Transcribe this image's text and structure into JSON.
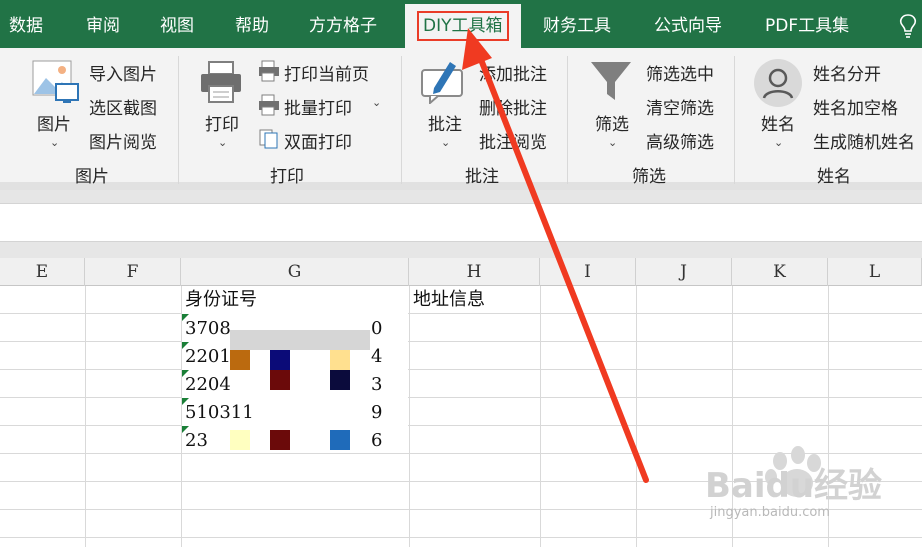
{
  "tabs": [
    "数据",
    "审阅",
    "视图",
    "帮助",
    "方方格子",
    "DIY工具箱",
    "财务工具",
    "公式向导",
    "PDF工具集"
  ],
  "active_tab": "DIY工具箱",
  "ribbon": {
    "picture": {
      "big_button": "图片",
      "items": [
        "导入图片",
        "选区截图",
        "图片阅览"
      ],
      "group_label": "图片"
    },
    "print": {
      "big_button": "打印",
      "items": [
        "打印当前页",
        "批量打印",
        "双面打印"
      ],
      "group_label": "打印"
    },
    "comment": {
      "big_button": "批注",
      "items": [
        "添加批注",
        "删除批注",
        "批注阅览"
      ],
      "group_label": "批注"
    },
    "filter": {
      "big_button": "筛选",
      "items": [
        "筛选选中",
        "清空筛选",
        "高级筛选"
      ],
      "group_label": "筛选"
    },
    "name": {
      "big_button": "姓名",
      "items": [
        "姓名分开",
        "姓名加空格",
        "生成随机姓名"
      ],
      "group_label": "姓名"
    }
  },
  "columns": [
    "E",
    "F",
    "G",
    "H",
    "I",
    "J",
    "K",
    "L"
  ],
  "cells": {
    "g_header": "身份证号",
    "h_header": "地址信息",
    "rows": [
      {
        "left": "3708",
        "right": "0"
      },
      {
        "left": "2201",
        "right": "4"
      },
      {
        "left": "2204",
        "right": "3"
      },
      {
        "left": "510311",
        "right": "9"
      },
      {
        "left": "23",
        "right": "6"
      }
    ]
  },
  "watermark": {
    "logo": "Baidu经验",
    "url": "jingyan.baidu.com"
  },
  "colors": {
    "accent": "#217346",
    "highlight_box": "#ea3c28",
    "arrow": "#f03a21",
    "swatches": [
      "#bb6a0f",
      "#0b0b78",
      "#ffe08f",
      "#6b0a0a",
      "#0b0b3c",
      "#ffffc0",
      "#6b0a0a",
      "#1f6bba"
    ]
  }
}
